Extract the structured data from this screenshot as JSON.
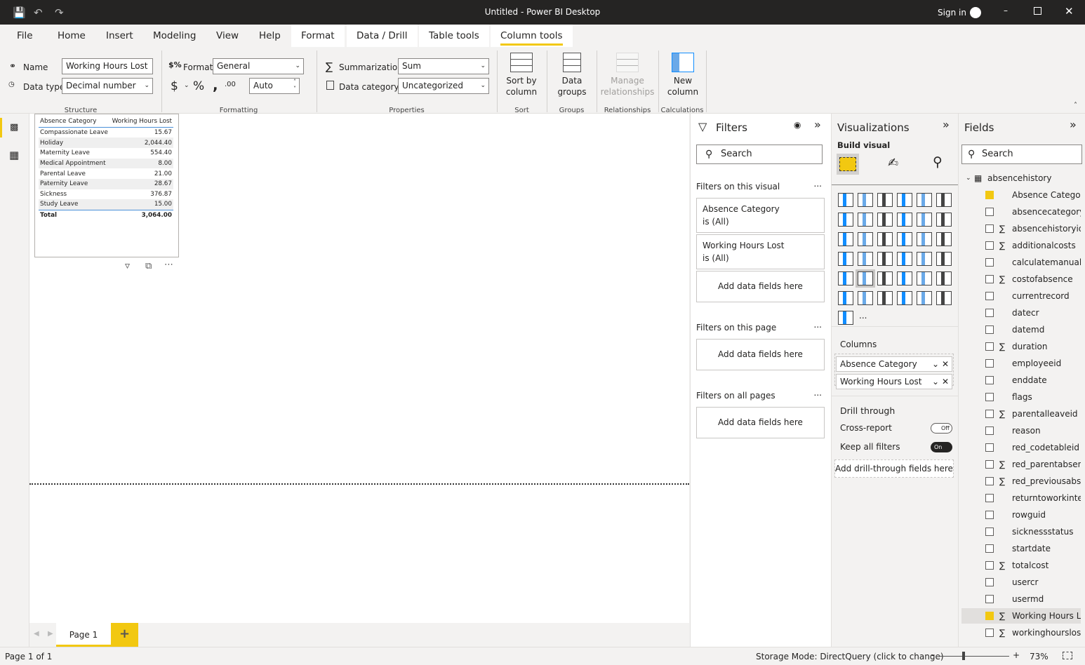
{
  "window": {
    "title": "Untitled - Power BI Desktop",
    "sign_in": "Sign in"
  },
  "tabs": [
    {
      "label": "File"
    },
    {
      "label": "Home"
    },
    {
      "label": "Insert"
    },
    {
      "label": "Modeling"
    },
    {
      "label": "View"
    },
    {
      "label": "Help"
    },
    {
      "label": "Format"
    },
    {
      "label": "Data / Drill"
    },
    {
      "label": "Table tools"
    },
    {
      "label": "Column tools",
      "active": true
    }
  ],
  "ribbon": {
    "name_label": "Name",
    "name_value": "Working Hours Lost",
    "datatype_label": "Data type",
    "datatype_value": "Decimal number",
    "format_label": "Format",
    "format_value": "General",
    "currency": "$",
    "percent": "%",
    "comma": ",",
    "decimals_value": "Auto",
    "summarization_label": "Summarization",
    "summarization_value": "Sum",
    "datacategory_label": "Data category",
    "datacategory_value": "Uncategorized",
    "sort_by": "Sort by",
    "sort_column": "column",
    "data_groups_1": "Data",
    "data_groups_2": "groups",
    "manage_1": "Manage",
    "manage_2": "relationships",
    "new_col_1": "New",
    "new_col_2": "column",
    "groups": [
      "Structure",
      "Formatting",
      "Properties",
      "Sort",
      "Groups",
      "Relationships",
      "Calculations"
    ]
  },
  "table_visual": {
    "headers": [
      "Absence Category",
      "Working Hours Lost"
    ],
    "rows": [
      [
        "Compassionate Leave",
        "15.67"
      ],
      [
        "Holiday",
        "2,044.40"
      ],
      [
        "Maternity Leave",
        "554.40"
      ],
      [
        "Medical Appointment",
        "8.00"
      ],
      [
        "Parental Leave",
        "21.00"
      ],
      [
        "Paternity Leave",
        "28.67"
      ],
      [
        "Sickness",
        "376.87"
      ],
      [
        "Study Leave",
        "15.00"
      ]
    ],
    "total": [
      "Total",
      "3,064.00"
    ]
  },
  "pages": {
    "tabs": [
      "Page 1"
    ],
    "add": "+"
  },
  "filters": {
    "title": "Filters",
    "search_placeholder": "Search",
    "on_visual": "Filters on this visual",
    "on_page": "Filters on this page",
    "on_all": "Filters on all pages",
    "more": "...",
    "cards": [
      {
        "field": "Absence Category",
        "state": "is (All)"
      },
      {
        "field": "Working Hours Lost",
        "state": "is (All)"
      }
    ],
    "add_fields": "Add data fields here"
  },
  "visualizations": {
    "title": "Visualizations",
    "build_visual": "Build visual",
    "columns_label": "Columns",
    "wells": [
      "Absence Category",
      "Working Hours Lost"
    ],
    "drill_through": "Drill through",
    "cross_report": "Cross-report",
    "cross_report_state": "Off",
    "keep_filters": "Keep all filters",
    "keep_filters_state": "On",
    "add_drill": "Add drill-through fields here",
    "more": "...",
    "icons": [
      "stacked-bar",
      "stacked-column",
      "clustered-bar",
      "clustered-column",
      "100-bar",
      "100-column",
      "line",
      "area",
      "stacked-area",
      "line-column",
      "line-clustered-column",
      "ribbon",
      "waterfall",
      "funnel",
      "scatter",
      "pie",
      "donut",
      "treemap",
      "map",
      "filled-map",
      "gauge",
      "card",
      "multi-row-card",
      "kpi",
      "slicer",
      "table",
      "matrix",
      "r-visual",
      "python-visual",
      "key-influencers",
      "decomposition-tree",
      "qa",
      "smart-narrative",
      "paginated-report",
      "azure-map",
      "power-apps",
      "power-automate"
    ]
  },
  "fields": {
    "title": "Fields",
    "search_placeholder": "Search",
    "table": "absencehistory",
    "items": [
      {
        "name": "Absence Category",
        "checked": true,
        "sigma": false
      },
      {
        "name": "absencecategory",
        "checked": false,
        "sigma": false
      },
      {
        "name": "absencehistoryid",
        "checked": false,
        "sigma": true
      },
      {
        "name": "additionalcosts",
        "checked": false,
        "sigma": true
      },
      {
        "name": "calculatemanually",
        "checked": false,
        "sigma": false
      },
      {
        "name": "costofabsence",
        "checked": false,
        "sigma": true
      },
      {
        "name": "currentrecord",
        "checked": false,
        "sigma": false
      },
      {
        "name": "datecr",
        "checked": false,
        "sigma": false
      },
      {
        "name": "datemd",
        "checked": false,
        "sigma": false
      },
      {
        "name": "duration",
        "checked": false,
        "sigma": true
      },
      {
        "name": "employeeid",
        "checked": false,
        "sigma": false
      },
      {
        "name": "enddate",
        "checked": false,
        "sigma": false
      },
      {
        "name": "flags",
        "checked": false,
        "sigma": false
      },
      {
        "name": "parentalleaveid",
        "checked": false,
        "sigma": true
      },
      {
        "name": "reason",
        "checked": false,
        "sigma": false
      },
      {
        "name": "red_codetableid",
        "checked": false,
        "sigma": false
      },
      {
        "name": "red_parentabsen...",
        "checked": false,
        "sigma": true
      },
      {
        "name": "red_previousabs...",
        "checked": false,
        "sigma": true
      },
      {
        "name": "returntoworkinte...",
        "checked": false,
        "sigma": false
      },
      {
        "name": "rowguid",
        "checked": false,
        "sigma": false
      },
      {
        "name": "sicknessstatus",
        "checked": false,
        "sigma": false
      },
      {
        "name": "startdate",
        "checked": false,
        "sigma": false
      },
      {
        "name": "totalcost",
        "checked": false,
        "sigma": true
      },
      {
        "name": "usercr",
        "checked": false,
        "sigma": false
      },
      {
        "name": "usermd",
        "checked": false,
        "sigma": false
      },
      {
        "name": "Working Hours L...",
        "checked": true,
        "sigma": true,
        "selected": true
      },
      {
        "name": "workinghourslost",
        "checked": false,
        "sigma": true
      }
    ]
  },
  "status": {
    "page": "Page 1 of 1",
    "storage": "Storage Mode: DirectQuery (click to change)",
    "zoom": "73%",
    "zoom_level_percent": 73
  },
  "colors": {
    "accent": "#f2c811",
    "titlebar": "#252423",
    "blue": "#118dff"
  }
}
